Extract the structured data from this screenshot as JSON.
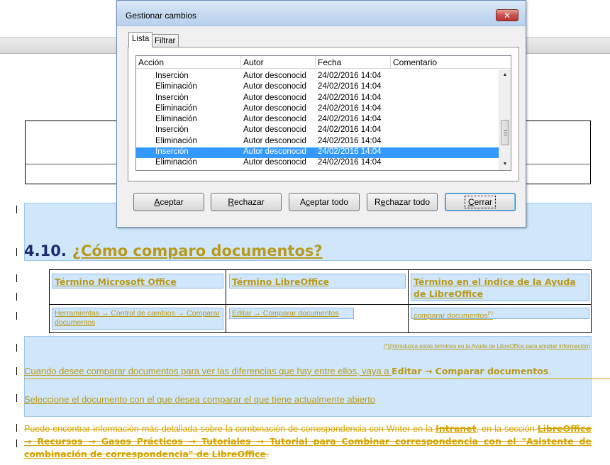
{
  "dialog": {
    "title": "Gestionar cambios",
    "tabs": [
      {
        "label": "Lista"
      },
      {
        "label": "Filtrar"
      }
    ],
    "columns": [
      "Acción",
      "Autor",
      "Fecha",
      "Comentario"
    ],
    "rows": [
      {
        "action": "Inserción",
        "author": "Autor desconocid",
        "date": "24/02/2016 14:04",
        "comment": ""
      },
      {
        "action": "Eliminación",
        "author": "Autor desconocid",
        "date": "24/02/2016 14:04",
        "comment": ""
      },
      {
        "action": "Inserción",
        "author": "Autor desconocid",
        "date": "24/02/2016 14:04",
        "comment": ""
      },
      {
        "action": "Eliminación",
        "author": "Autor desconocid",
        "date": "24/02/2016 14:04",
        "comment": ""
      },
      {
        "action": "Eliminación",
        "author": "Autor desconocid",
        "date": "24/02/2016 14:04",
        "comment": ""
      },
      {
        "action": "Inserción",
        "author": "Autor desconocid",
        "date": "24/02/2016 14:04",
        "comment": ""
      },
      {
        "action": "Eliminación",
        "author": "Autor desconocid",
        "date": "24/02/2016 14:04",
        "comment": ""
      },
      {
        "action": "Inserción",
        "author": "Autor desconocid",
        "date": "24/02/2016 14:04",
        "comment": "",
        "selected": true
      },
      {
        "action": "Eliminación",
        "author": "Autor desconocid",
        "date": "24/02/2016 14:04",
        "comment": ""
      }
    ],
    "buttons": {
      "accept": {
        "mnemonic": "A",
        "rest": "ceptar"
      },
      "reject": {
        "mnemonic": "R",
        "rest": "echazar"
      },
      "accept_all_pre": "A",
      "accept_all_mnemonic": "c",
      "accept_all_rest": "eptar todo",
      "reject_all_pre": "R",
      "reject_all_mnemonic": "e",
      "reject_all_rest": "chazar todo",
      "close": {
        "mnemonic": "C",
        "rest": "errar"
      }
    }
  },
  "document": {
    "section_number": "4.10.",
    "section_title": "¿Cómo comparo documentos?",
    "table": {
      "headers": [
        "Término Microsoft Office",
        "Término LibreOffice",
        "Término en el índice de la Ayuda de LibreOffice"
      ],
      "cells": [
        "Herramientas → Control de cambios → Comparar documentos",
        "Editar → Comparar documentos",
        "comparar documentos"
      ],
      "cell_sup": "(*)"
    },
    "note": "(*)(Introduzca estos términos en la Ayuda de LibreOffice para ampliar información)",
    "para1_pre": "Cuando desee comparar documentos para ver las diferencias que hay entre ellos, vaya a ",
    "para1_bold": "Editar → Comparar documentos",
    "para1_post": ".",
    "para2": "Seleccione el documento con el que desea comparar el que tiene actualmente abierto",
    "para3_a": "Puede encontrar información más detallada sobre la combinación de correspondencia con Writer en la ",
    "para3_b": "Intranet",
    "para3_c": ", en la sección ",
    "para3_d": "LibreOffice → Recursos → Gasos Prácticos → Tutoriales → Tutorial para Combinar correspondencia con el \"Asistente de combinación de correspondencia\" de LibreOffice",
    "para3_e": "."
  },
  "colors": {
    "accent_link": "#b89a1a",
    "selection": "#3399ff",
    "highlight_blue": "#cfe6fb",
    "tracked_change": "#d4a400"
  }
}
